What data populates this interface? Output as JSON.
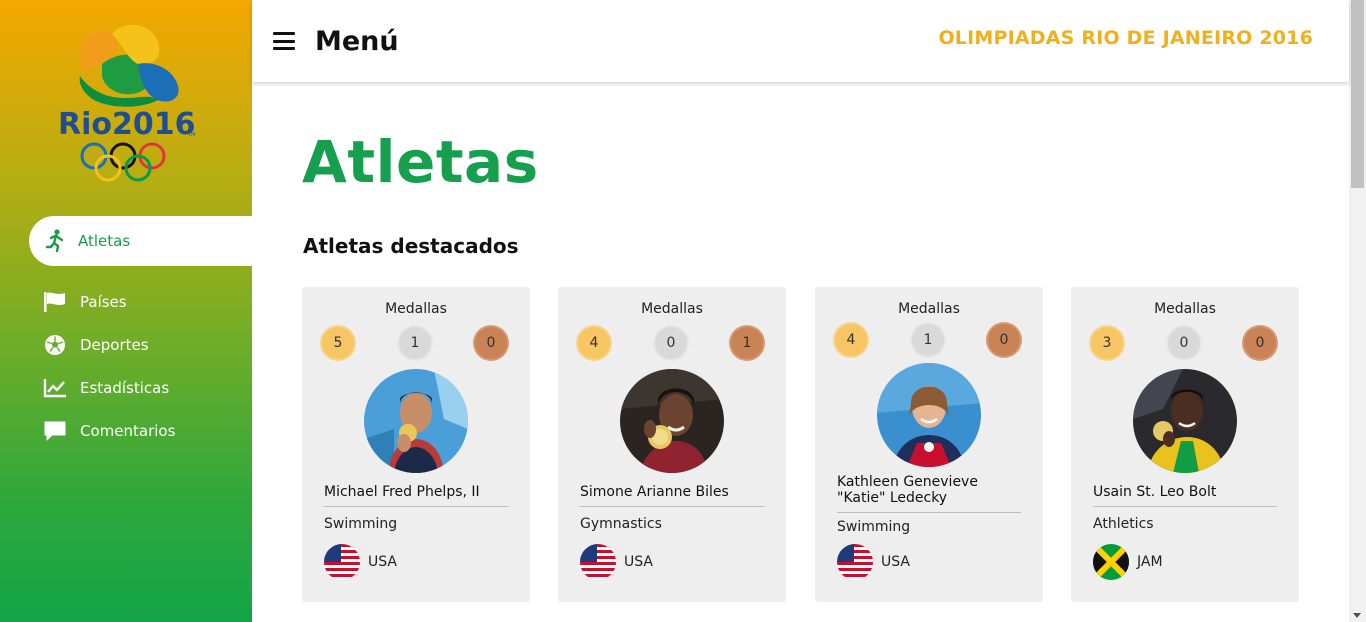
{
  "sidebar": {
    "logo": {
      "wordmark": "Rio2016",
      "trademark": "TM"
    },
    "items": [
      {
        "label": "Atletas",
        "icon": "runner-icon",
        "active": true
      },
      {
        "label": "Países",
        "icon": "flag-icon",
        "active": false
      },
      {
        "label": "Deportes",
        "icon": "soccer-ball-icon",
        "active": false
      },
      {
        "label": "Estadísticas",
        "icon": "line-chart-icon",
        "active": false
      },
      {
        "label": "Comentarios",
        "icon": "comment-icon",
        "active": false
      }
    ]
  },
  "header": {
    "menu_label": "Menú",
    "site_title": "OLIMPIADAS RIO DE JANEIRO 2016"
  },
  "main": {
    "page_title": "Atletas",
    "section_title": "Atletas destacados",
    "medals_label": "Medallas",
    "athletes": [
      {
        "name": "Michael Fred Phelps, II",
        "sport": "Swimming",
        "country": "USA",
        "flag": "usa-flag-icon",
        "gold": "5",
        "silver": "1",
        "bronze": "0"
      },
      {
        "name": "Simone Arianne Biles",
        "sport": "Gymnastics",
        "country": "USA",
        "flag": "usa-flag-icon",
        "gold": "4",
        "silver": "0",
        "bronze": "1"
      },
      {
        "name": "Kathleen Genevieve \"Katie\" Ledecky",
        "sport": "Swimming",
        "country": "USA",
        "flag": "usa-flag-icon",
        "gold": "4",
        "silver": "1",
        "bronze": "0"
      },
      {
        "name": "Usain St. Leo Bolt",
        "sport": "Athletics",
        "country": "JAM",
        "flag": "jamaica-flag-icon",
        "gold": "3",
        "silver": "0",
        "bronze": "0"
      }
    ]
  },
  "colors": {
    "accent_green": "#16a04e",
    "title_gold": "#f0b01e",
    "medal_gold": "#f8c565",
    "medal_silver": "#d9d9d9",
    "medal_bronze": "#c98355",
    "card_bg": "#eeeeee"
  }
}
